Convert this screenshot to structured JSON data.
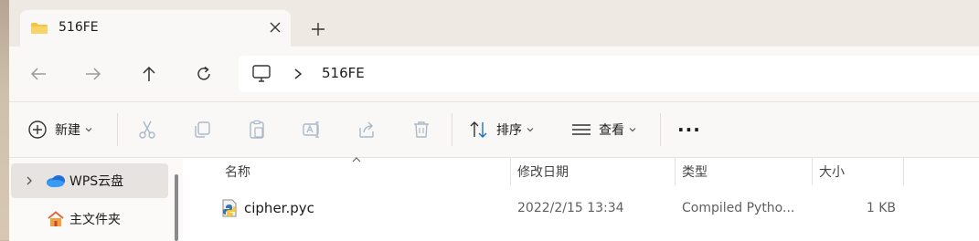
{
  "tab": {
    "title": "516FE"
  },
  "address": {
    "path_segment": "516FE"
  },
  "toolbar": {
    "new_label": "新建",
    "sort_label": "排序",
    "view_label": "查看",
    "more_label": "···"
  },
  "sidebar": {
    "items": [
      {
        "label": "WPS云盘"
      },
      {
        "label": "主文件夹"
      }
    ]
  },
  "columns": {
    "name": "名称",
    "modified": "修改日期",
    "type": "类型",
    "size": "大小"
  },
  "files": [
    {
      "name": "cipher.pyc",
      "modified": "2022/2/15 13:34",
      "type": "Compiled Pytho...",
      "size": "1 KB"
    }
  ],
  "colors": {
    "titlebar": "#efe9e3",
    "toolbar": "#faf8f6",
    "selected_sidebar": "#e6e3e0",
    "disabled_icon": "#a9b9c9",
    "folder_yellow": "#f4c542"
  }
}
